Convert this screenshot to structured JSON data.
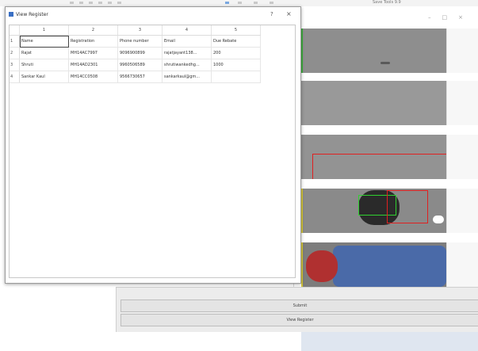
{
  "background_window": {
    "title_fragment": "Save  Tools 9.9",
    "window_controls": [
      "–",
      "□",
      "×"
    ]
  },
  "dialog": {
    "title": "View Register",
    "help_button": "?",
    "close_button": "×"
  },
  "register_table": {
    "column_headers": [
      "1",
      "2",
      "3",
      "4",
      "5"
    ],
    "row_headers": [
      "1",
      "2",
      "3",
      "4"
    ],
    "rows": [
      [
        "Name",
        "Registration",
        "Phone number",
        "Email",
        "Due Rebate"
      ],
      [
        "Rajat",
        "MH14AC7997",
        "9096900899",
        "rajatjayant138...",
        "200"
      ],
      [
        "Shruti",
        "MH14AD2301",
        "9960506589",
        "shrutiwankedhg...",
        "1000"
      ],
      [
        "Sankar Kaul",
        "MH14CC0508",
        "9566730657",
        "sankarkaul@gm...",
        ""
      ]
    ],
    "selected_cell": "Name"
  },
  "buttons": {
    "submit": "Submit",
    "view_register": "View Register"
  },
  "colors": {
    "detection_box": "#e02020",
    "helmet_box": "#30d030",
    "footer": "#dfe6f0"
  }
}
